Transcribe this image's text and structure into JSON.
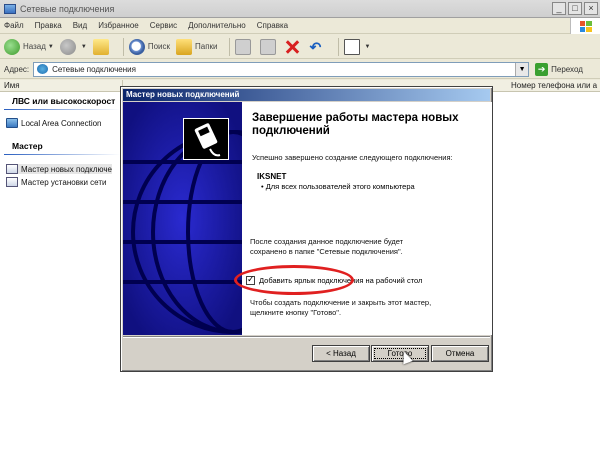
{
  "window": {
    "title": "Сетевые подключения",
    "controls": [
      "_",
      "□",
      "×"
    ]
  },
  "menu": [
    "Файл",
    "Правка",
    "Вид",
    "Избранное",
    "Сервис",
    "Дополнительно",
    "Справка"
  ],
  "toolbar": {
    "back": "Назад",
    "search": "Поиск",
    "folders": "Папки"
  },
  "address": {
    "label": "Адрес:",
    "value": "Сетевые подключения",
    "go": "Переход"
  },
  "columns": {
    "name": "Имя",
    "phone": "Номер телефона или а"
  },
  "groups": {
    "lan": {
      "heading": "ЛВС или высокоскорост",
      "item": "Local Area Connection"
    },
    "wizard": {
      "heading": "Мастер",
      "items": [
        "Мастер новых подключе",
        "Мастер установки сети"
      ]
    }
  },
  "dialog": {
    "title": "Мастер новых подключений",
    "heading": "Завершение работы мастера новых подключений",
    "success": "Успешно завершено создание следующего подключения:",
    "connection_name": "IKSNET",
    "bullet": "Для всех пользователей этого компьютера",
    "saved_note": "После создания данное подключение будет сохранено в папке \"Сетевые подключения\".",
    "checkbox_label": "Добавить ярлык подключения на рабочий стол",
    "checkbox_checked": true,
    "finish_hint": "Чтобы создать подключение и закрыть этот мастер, щелкните кнопку \"Готово\".",
    "buttons": {
      "back": "< Назад",
      "finish": "Готово",
      "cancel": "Отмена"
    }
  },
  "colors": {
    "title_gradient_start": "#0a246a",
    "banner": "#1818a0",
    "highlight_ellipse": "#e02020"
  }
}
